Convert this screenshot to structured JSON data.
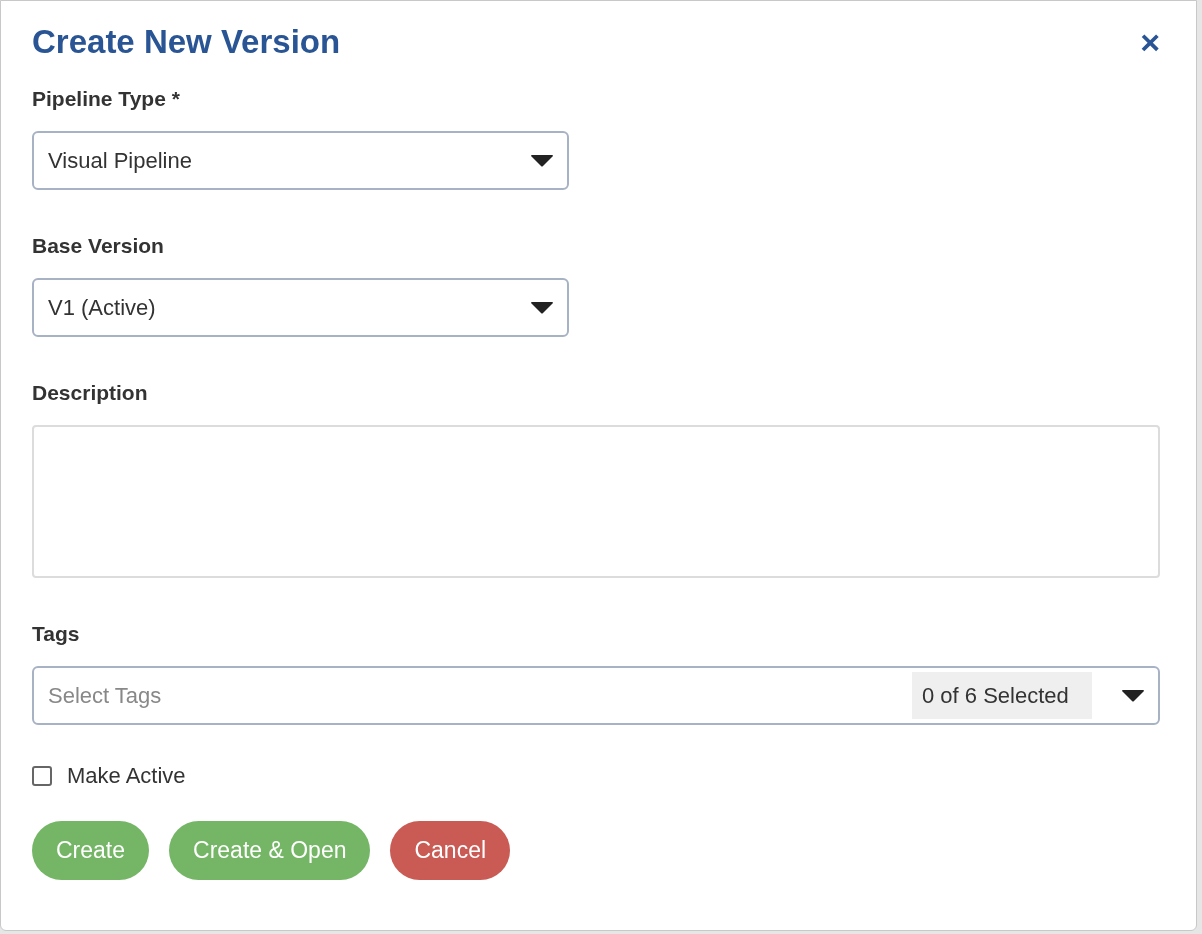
{
  "dialog": {
    "title": "Create New Version",
    "close": "×"
  },
  "fields": [
    {
      "kind": "select",
      "label": "Pipeline Type *",
      "value": "Visual Pipeline"
    },
    {
      "kind": "select",
      "label": "Base Version",
      "value": "V1 (Active)"
    },
    {
      "kind": "textarea",
      "label": "Description"
    },
    {
      "kind": "multiselect",
      "label": "Tags",
      "placeholder": "Select Tags",
      "count": "0 of 6 Selected"
    }
  ],
  "checkbox": {
    "label": "Make Active",
    "checked": false
  },
  "buttons": [
    {
      "label": "Create",
      "kind": "confirm"
    },
    {
      "label": "Create & Open",
      "kind": "confirm"
    },
    {
      "label": "Cancel",
      "kind": "cancel"
    }
  ]
}
